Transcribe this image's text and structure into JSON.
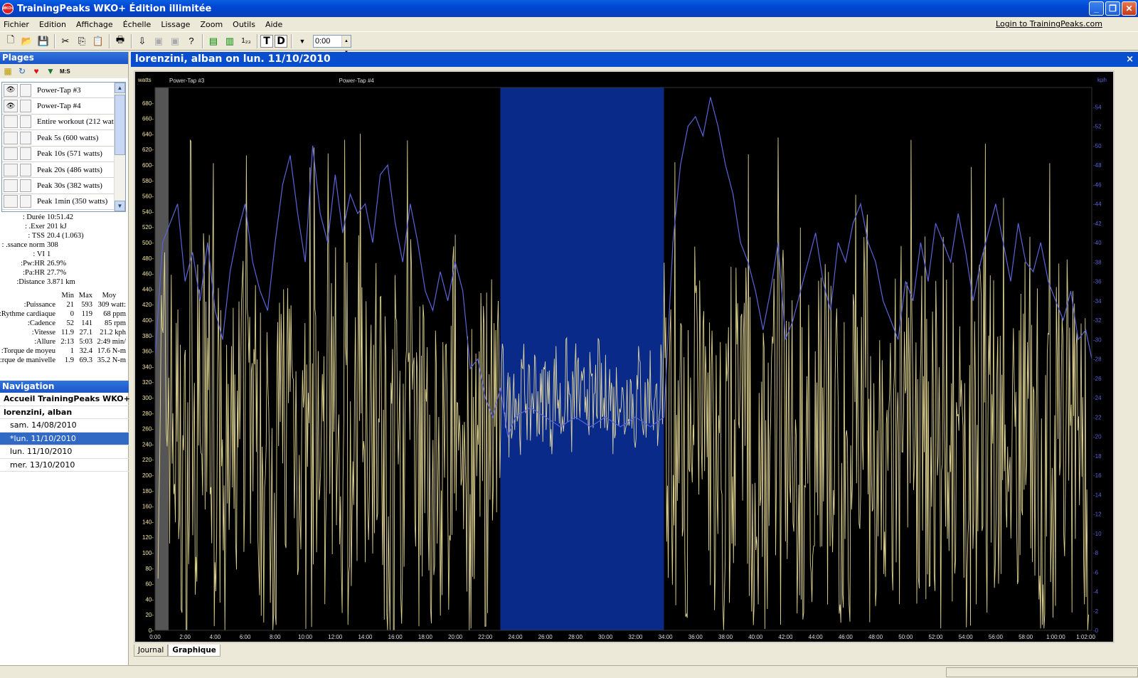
{
  "window": {
    "title": "TrainingPeaks WKO+ Édition illimitée",
    "icon_text": "WKO+"
  },
  "menu": [
    "Fichier",
    "Edition",
    "Affichage",
    "Échelle",
    "Lissage",
    "Zoom",
    "Outils",
    "Aide"
  ],
  "login_link": "Login to TrainingPeaks.com",
  "toolbar": {
    "time_value": "0:00",
    "t_label": "T",
    "d_label": "D",
    "numbers_label": "1₂₃"
  },
  "ranges_panel": {
    "title": "Plages",
    "icon_ms": "M:S",
    "items": [
      {
        "label": "Power-Tap #3",
        "visible": true
      },
      {
        "label": "Power-Tap #4",
        "visible": true
      },
      {
        "label": "Entire workout (212 watt",
        "visible": false
      },
      {
        "label": "Peak 5s (600 watts)",
        "visible": false
      },
      {
        "label": "Peak 10s (571 watts)",
        "visible": false
      },
      {
        "label": "Peak 20s (486 watts)",
        "visible": false
      },
      {
        "label": "Peak 30s (382 watts)",
        "visible": false
      },
      {
        "label": "Peak 1min (350 watts)",
        "visible": false
      }
    ]
  },
  "summary": [
    {
      "k": "Durée :",
      "v": "10:51.42"
    },
    {
      "k": "Exer. :",
      "v": "201 kJ"
    },
    {
      "k": "TSS :",
      "v": "20.4 (1.063)"
    },
    {
      "k": "ssance norm. :",
      "v": "308"
    },
    {
      "k": "VI :",
      "v": "1"
    },
    {
      "k": "Pw:HR:",
      "v": "26.9%"
    },
    {
      "k": "Pa:HR:",
      "v": "27.7%"
    },
    {
      "k": "Distance:",
      "v": "3.871 km"
    }
  ],
  "minmax": {
    "headers": [
      "Min",
      "Max",
      "Moy"
    ],
    "rows": [
      {
        "k": "Puissance:",
        "min": "21",
        "max": "593",
        "avg": "309 watt:"
      },
      {
        "k": "Rythme cardiaque:",
        "min": "0",
        "max": "119",
        "avg": "68 ppm"
      },
      {
        "k": "Cadence:",
        "min": "52",
        "max": "141",
        "avg": "85 rpm"
      },
      {
        "k": "Vitesse:",
        "min": "11.9",
        "max": "27.1",
        "avg": "21.2 kph"
      },
      {
        "k": "Allure:",
        "min": "2:13",
        "max": "5:03",
        "avg": "2:49 min/"
      },
      {
        "k": "Torque de moyeu:",
        "min": "1",
        "max": "32.4",
        "avg": "17.6 N-m"
      },
      {
        "k": "rque de manivelle:",
        "min": "1.9",
        "max": "69.3",
        "avg": "35.2 N-m"
      }
    ]
  },
  "navigation": {
    "title": "Navigation",
    "home": "Accueil TrainingPeaks WKO+",
    "athlete": "lorenzini, alban",
    "entries": [
      {
        "label": "sam. 14/08/2010",
        "selected": false
      },
      {
        "label": "*lun. 11/10/2010",
        "selected": true
      },
      {
        "label": "lun. 11/10/2010",
        "selected": false
      },
      {
        "label": "mer. 13/10/2010",
        "selected": false
      }
    ]
  },
  "document": {
    "title": "lorenzini, alban on lun. 11/10/2010",
    "close": "×"
  },
  "tabs": [
    {
      "label": "Journal",
      "active": false
    },
    {
      "label": "Graphique",
      "active": true
    }
  ],
  "colors": {
    "power": "#f3e6a0",
    "speed": "#5a64d8",
    "selection": "#0a2a8a",
    "background": "#000000"
  },
  "chart_data": {
    "type": "line",
    "left_axis_unit": "watts",
    "right_axis_unit": "kph",
    "left_ticks": [
      "0-",
      "20-",
      "40-",
      "60-",
      "80-",
      "100-",
      "120-",
      "140-",
      "160-",
      "180-",
      "200-",
      "220-",
      "240-",
      "260-",
      "280-",
      "300-",
      "320-",
      "340-",
      "360-",
      "380-",
      "400-",
      "420-",
      "440-",
      "460-",
      "480-",
      "500-",
      "520-",
      "540-",
      "560-",
      "580-",
      "600-",
      "620-",
      "640-",
      "660-",
      "680-"
    ],
    "right_ticks": [
      "-0",
      "-2",
      "-4",
      "-6",
      "-8",
      "-10",
      "-12",
      "-14",
      "-16",
      "-18",
      "-20",
      "-22",
      "-24",
      "-26",
      "-28",
      "-30",
      "-32",
      "-34",
      "-36",
      "-38",
      "-40",
      "-42",
      "-44",
      "-46",
      "-48",
      "-50",
      "-52",
      "-54"
    ],
    "x_ticks": [
      "0:00",
      "2:00",
      "4:00",
      "6:00",
      "8:00",
      "10:00",
      "12:00",
      "14:00",
      "16:00",
      "18:00",
      "20:00",
      "22:00",
      "24:00",
      "26:00",
      "28:00",
      "30:00",
      "32:00",
      "34:00",
      "36:00",
      "38:00",
      "40:00",
      "42:00",
      "44:00",
      "46:00",
      "48:00",
      "50:00",
      "52:00",
      "54:00",
      "56:00",
      "58:00",
      "1:00:00",
      "1:02:00"
    ],
    "ylim_left": [
      0,
      700
    ],
    "ylim_right": [
      0,
      56
    ],
    "xlim_min": [
      0,
      62.4
    ],
    "range_markers": [
      {
        "label": "Power-Tap #3",
        "t": 0.9
      },
      {
        "label": "Power-Tap #4",
        "t": 12.2
      }
    ],
    "selection": [
      23.0,
      33.9
    ],
    "speed_series": {
      "name": "Vitesse (kph)",
      "t": [
        0,
        0.5,
        1,
        1.5,
        2,
        2.5,
        3,
        3.5,
        4,
        4.5,
        5,
        5.5,
        6,
        6.5,
        7,
        7.5,
        8,
        8.5,
        9,
        9.5,
        10,
        10.5,
        11,
        11.5,
        12,
        12.5,
        13,
        13.5,
        14,
        14.5,
        15,
        15.5,
        16,
        16.5,
        17,
        17.5,
        18,
        18.5,
        19,
        19.5,
        20,
        20.5,
        21,
        21.5,
        22,
        22.5,
        23,
        23.5,
        24,
        25,
        26,
        27,
        28,
        29,
        30,
        31,
        32,
        33,
        33.9,
        34.5,
        35,
        35.5,
        36,
        36.5,
        37,
        37.5,
        38,
        38.5,
        39,
        39.5,
        40,
        40.5,
        41,
        41.5,
        42,
        42.5,
        43,
        43.5,
        44,
        44.5,
        45,
        45.5,
        46,
        46.5,
        47,
        47.5,
        48,
        48.5,
        49,
        49.5,
        50,
        50.5,
        51,
        51.5,
        52,
        52.5,
        53,
        53.5,
        54,
        54.5,
        55,
        55.5,
        56,
        56.5,
        57,
        57.5,
        58,
        58.5,
        59,
        59.5,
        60,
        60.5,
        61,
        61.5,
        62,
        62.4
      ],
      "v": [
        28,
        40,
        42,
        44,
        36,
        39,
        34,
        40,
        33,
        30,
        37,
        41,
        44,
        38,
        35,
        33,
        40,
        46,
        49,
        43,
        38,
        50,
        43,
        40,
        47,
        41,
        45,
        43,
        44,
        40,
        47,
        48,
        42,
        38,
        44,
        40,
        35,
        33,
        37,
        34,
        38,
        35,
        27,
        28,
        24,
        22,
        25,
        20,
        22,
        23,
        22,
        21,
        22,
        21,
        22,
        21,
        22,
        21,
        22,
        40,
        48,
        52,
        53,
        51,
        55,
        52,
        48,
        45,
        40,
        38,
        35,
        31,
        35,
        40,
        30,
        32,
        35,
        38,
        41,
        36,
        33,
        40,
        38,
        42,
        44,
        40,
        38,
        34,
        32,
        30,
        36,
        34,
        40,
        36,
        42,
        40,
        38,
        43,
        39,
        34,
        38,
        41,
        44,
        40,
        36,
        42,
        38,
        37,
        40,
        36,
        34,
        32,
        35,
        30,
        31,
        28,
        20,
        0
      ],
      "note": "approx. readings"
    },
    "power_series": {
      "name": "Puissance (watts)",
      "note": "dense oscillating trace, approx. 0-650 watts"
    }
  }
}
